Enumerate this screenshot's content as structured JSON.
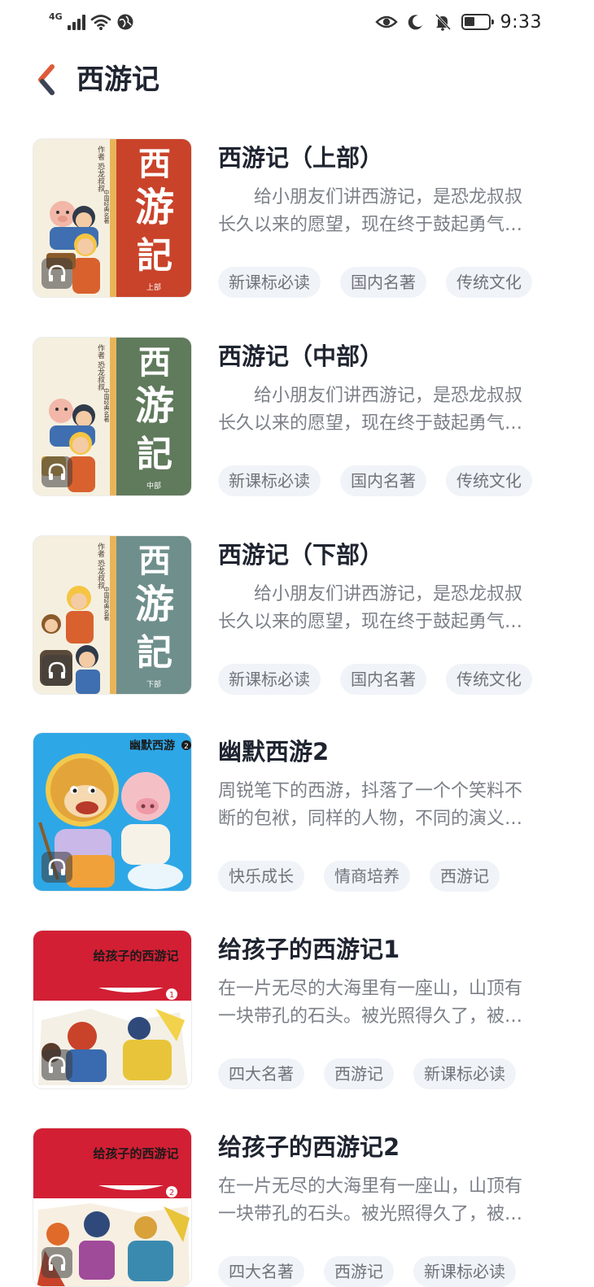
{
  "status_bar": {
    "network": "4G",
    "time": "9:33"
  },
  "header": {
    "title": "西游记",
    "back_icon": "chevron-left-icon"
  },
  "colors": {
    "accent_red": "#e05a3a",
    "cover_red": "#c9432a",
    "cover_green": "#607a5c",
    "cover_teal": "#6f8f8c",
    "cover_blue": "#2ea7e6",
    "cover_crimson": "#d21f34",
    "tag_bg": "#f0f3f8"
  },
  "books": [
    {
      "title": "西游记（上部）",
      "desc_line1": "　　给小朋友们讲西游记，是恐龙叔叔",
      "desc_line2": "长久以来的愿望，现在终于鼓起勇气…",
      "tags": [
        "新课标必读",
        "国内名著",
        "传统文化"
      ],
      "cover_calligraphy": [
        "西",
        "游",
        "記"
      ],
      "cover_author": "作者 恐龙叔叔",
      "cover_series": "中国经典名著",
      "cover_part": "上部",
      "audio_icon": "headphones-icon"
    },
    {
      "title": "西游记（中部）",
      "desc_line1": "　　给小朋友们讲西游记，是恐龙叔叔",
      "desc_line2": "长久以来的愿望，现在终于鼓起勇气…",
      "tags": [
        "新课标必读",
        "国内名著",
        "传统文化"
      ],
      "cover_calligraphy": [
        "西",
        "游",
        "記"
      ],
      "cover_author": "作者 恐龙叔叔",
      "cover_series": "中国经典名著",
      "cover_part": "中部",
      "audio_icon": "headphones-icon"
    },
    {
      "title": "西游记（下部）",
      "desc_line1": "　　给小朋友们讲西游记，是恐龙叔叔",
      "desc_line2": "长久以来的愿望，现在终于鼓起勇气…",
      "tags": [
        "新课标必读",
        "国内名著",
        "传统文化"
      ],
      "cover_calligraphy": [
        "西",
        "游",
        "記"
      ],
      "cover_author": "作者 恐龙叔叔",
      "cover_series": "中国经典名著",
      "cover_part": "下部",
      "audio_icon": "headphones-icon"
    },
    {
      "title": "幽默西游2",
      "desc_line1": "周锐笔下的西游，抖落了一个个笑料不",
      "desc_line2": "断的包袱，同样的人物，不同的演义…",
      "tags": [
        "快乐成长",
        "情商培养",
        "西游记"
      ],
      "cover_logo": "幽默西游",
      "cover_logo_num": "2",
      "audio_icon": "headphones-icon"
    },
    {
      "title": "给孩子的西游记1",
      "desc_line1": "在一片无尽的大海里有一座山，山顶有",
      "desc_line2": "一块带孔的石头。被光照得久了，被…",
      "tags": [
        "四大名著",
        "西游记",
        "新课标必读"
      ],
      "cover_heading": "给孩子的西游记",
      "cover_num": "1",
      "audio_icon": "headphones-icon"
    },
    {
      "title": "给孩子的西游记2",
      "desc_line1": "在一片无尽的大海里有一座山，山顶有",
      "desc_line2": "一块带孔的石头。被光照得久了，被…",
      "tags": [
        "四大名著",
        "西游记",
        "新课标必读"
      ],
      "cover_heading": "给孩子的西游记",
      "cover_num": "2",
      "audio_icon": "headphones-icon"
    }
  ]
}
